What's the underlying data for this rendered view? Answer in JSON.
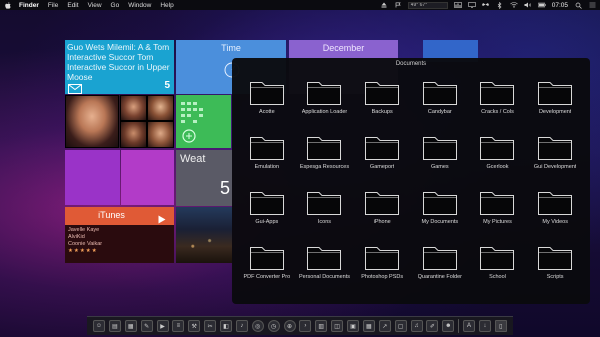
{
  "menubar": {
    "apple_icon": "apple-icon",
    "app_name": "Finder",
    "items": [
      "File",
      "Edit",
      "View",
      "Go",
      "Window",
      "Help"
    ],
    "field_value": "49° 67°",
    "clock": "07:05"
  },
  "tiles": {
    "news": {
      "text": "Guo Wets Milemil: A & Tom Interactive Succor Tom Interactive Succor in Upper Moose",
      "count": "5"
    },
    "time": {
      "label": "Time"
    },
    "calendar": {
      "label": "December"
    },
    "weather": {
      "label": "Weat",
      "temp": "5"
    },
    "itunes": {
      "label": "iTunes",
      "track_line1": "Javelle Kaye",
      "track_line2": "AlviKid",
      "track_line3": "Coonie Vaikar",
      "rating": "★★★★★"
    }
  },
  "stack": {
    "title": "Documents",
    "folders": [
      {
        "label": "Acotte"
      },
      {
        "label": "Application Loader"
      },
      {
        "label": "Backups"
      },
      {
        "label": "Candybar"
      },
      {
        "label": "Cracks / Cols"
      },
      {
        "label": "Development"
      },
      {
        "label": "Emulation"
      },
      {
        "label": "Espesga Resources"
      },
      {
        "label": "Gameport"
      },
      {
        "label": "Games"
      },
      {
        "label": "Gcerlook"
      },
      {
        "label": "Gui Development"
      },
      {
        "label": "Gui-Apps"
      },
      {
        "label": "Icons"
      },
      {
        "label": "iPhone"
      },
      {
        "label": "My Documents"
      },
      {
        "label": "My Pictures"
      },
      {
        "label": "My Videos"
      },
      {
        "label": "PDF Converter Pro"
      },
      {
        "label": "Personal Documents"
      },
      {
        "label": "Photoshop PSDs"
      },
      {
        "label": "Quarantine Folder"
      },
      {
        "label": "School"
      },
      {
        "label": "Scripts"
      }
    ]
  },
  "dock": {
    "icons": [
      "finder-icon",
      "document-icon",
      "calendar-icon",
      "notes-icon",
      "video-icon",
      "reader-icon",
      "tools-icon",
      "scissors-icon",
      "photo-icon",
      "music-icon",
      "dashboard-icon",
      "clock-icon",
      "safari-icon",
      "terminal-icon",
      "chart-icon",
      "preview-icon",
      "image-icon",
      "grid-icon",
      "stocks-icon",
      "pdf-icon",
      "audio-icon",
      "editor-icon",
      "contacts-icon",
      "documents-stack-icon",
      "downloads-stack-icon",
      "trash-icon"
    ]
  }
}
